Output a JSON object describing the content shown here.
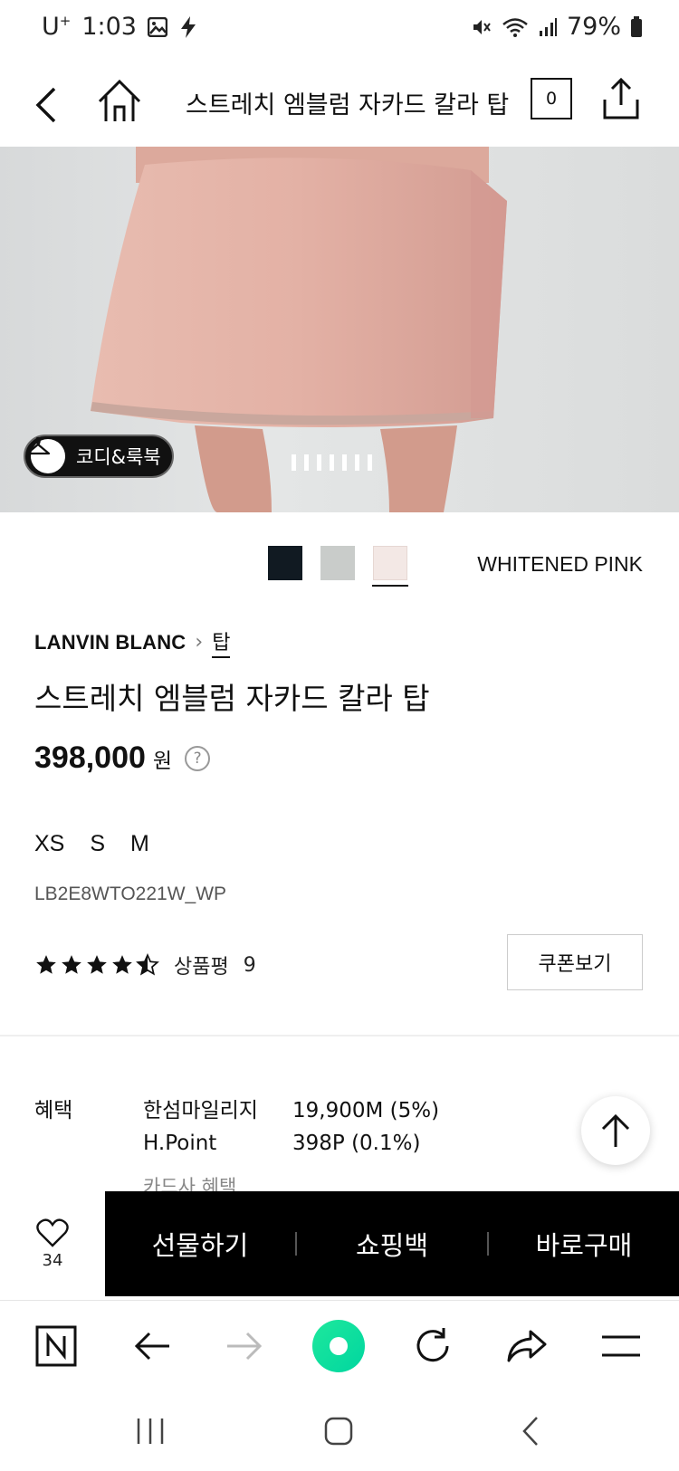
{
  "status": {
    "carrier": "U",
    "carrier_sup": "+",
    "time": "1:03",
    "battery": "79%"
  },
  "nav": {
    "title": "스트레치 엠블럼 자카드 칼라 탑",
    "cart_count": "0"
  },
  "gallery": {
    "codi_label": "코디&룩북",
    "slide_count": 7
  },
  "colors": {
    "swatches": [
      "#111a22",
      "#c9ccca",
      "#f3e8e5"
    ],
    "selected_index": 2,
    "selected_name": "WHITENED PINK"
  },
  "product": {
    "brand": "LANVIN BLANC",
    "category": "탑",
    "title": "스트레치 엠블럼 자카드 칼라 탑",
    "price": "398,000",
    "currency": "원",
    "sizes": [
      "XS",
      "S",
      "M"
    ],
    "code": "LB2E8WTO221W_WP",
    "rating": 4.5,
    "review_label": "상품평",
    "review_count": "9",
    "coupon_label": "쿠폰보기"
  },
  "benefits": {
    "title": "혜택",
    "rows": [
      {
        "key": "한섬마일리지",
        "value": "19,900M (5%)"
      },
      {
        "key": "H.Point",
        "value": "398P (0.1%)"
      },
      {
        "key": "카드사 혜택",
        "value": ""
      }
    ]
  },
  "actions": {
    "wish_count": "34",
    "gift": "선물하기",
    "bag": "쇼핑백",
    "buy_now": "바로구매"
  }
}
